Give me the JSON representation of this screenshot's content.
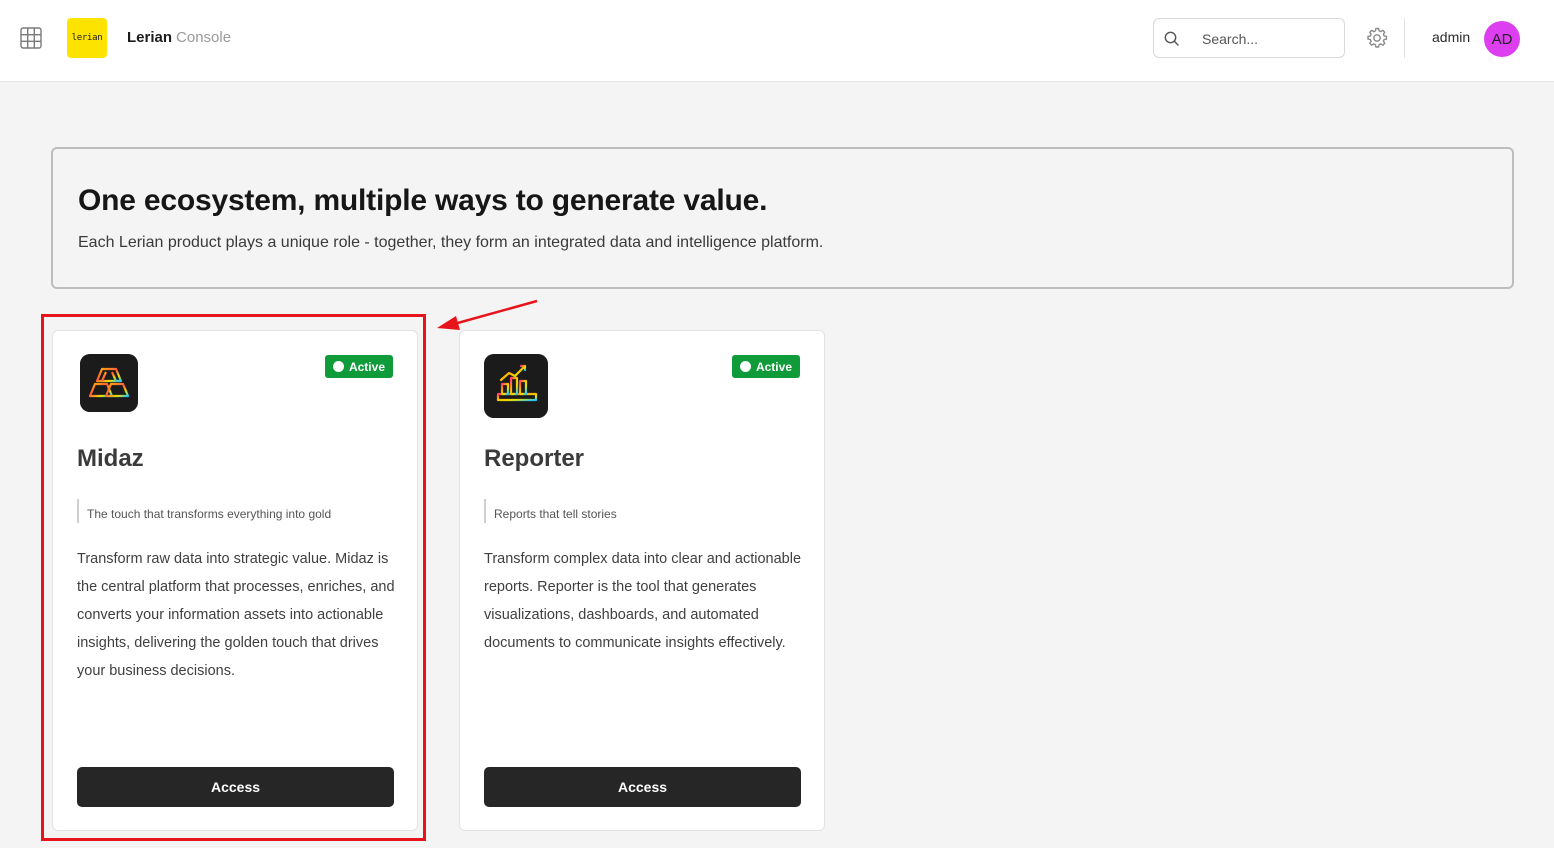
{
  "header": {
    "apps_icon": "grid-icon",
    "logo_text": "lerian",
    "brand_name": "Lerian",
    "brand_suffix": "Console",
    "search_placeholder": "Search...",
    "settings_icon": "gear-icon",
    "username": "admin",
    "avatar_initials": "AD",
    "avatar_color": "#dc3ef0"
  },
  "hero": {
    "title": "One ecosystem, multiple ways to generate value.",
    "subtitle": "Each Lerian product plays a unique role - together, they form an integrated data and intelligence platform."
  },
  "products": [
    {
      "name": "Midaz",
      "status": "Active",
      "tagline": "The touch that transforms everything into gold",
      "description": "Transform raw data into strategic value. Midaz is the central platform that processes, enriches, and converts your information assets into actionable insights, delivering the golden touch that drives your business decisions.",
      "button_label": "Access",
      "icon": "gold-bars-icon"
    },
    {
      "name": "Reporter",
      "status": "Active",
      "tagline": "Reports that tell stories",
      "description": "Transform complex data into clear and actionable reports. Reporter is the tool that generates visualizations, dashboards, and automated documents to communicate insights effectively.",
      "button_label": "Access",
      "icon": "report-chart-icon"
    }
  ],
  "colors": {
    "active_badge": "#0f9b3a",
    "logo_bg": "#fde400",
    "annotation": "#e8141b",
    "button_bg": "#262626"
  }
}
